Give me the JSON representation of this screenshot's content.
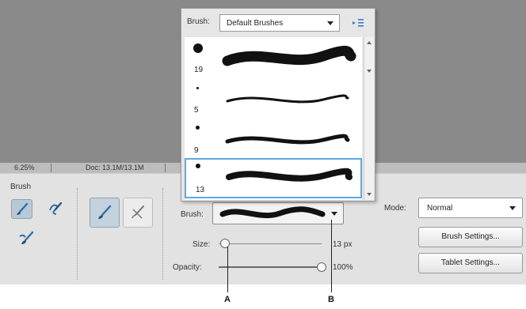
{
  "status": {
    "zoom": "6.25%",
    "doc": "Doc: 13.1M/13.1M"
  },
  "tool_options": {
    "tool_name": "Brush",
    "brush_label": "Brush:",
    "size_label": "Size:",
    "size_value": "13 px",
    "size_fraction": 0.06,
    "opacity_label": "Opacity:",
    "opacity_value": "100%",
    "opacity_fraction": 1.0,
    "mode_label": "Mode:",
    "mode_value": "Normal",
    "brush_settings_label": "Brush Settings...",
    "tablet_settings_label": "Tablet Settings..."
  },
  "brush_picker": {
    "label": "Brush:",
    "set_value": "Default Brushes",
    "brushes": [
      {
        "size": "19"
      },
      {
        "size": "5"
      },
      {
        "size": "9"
      },
      {
        "size": "13"
      }
    ]
  },
  "callouts": {
    "a": "A",
    "b": "B"
  }
}
